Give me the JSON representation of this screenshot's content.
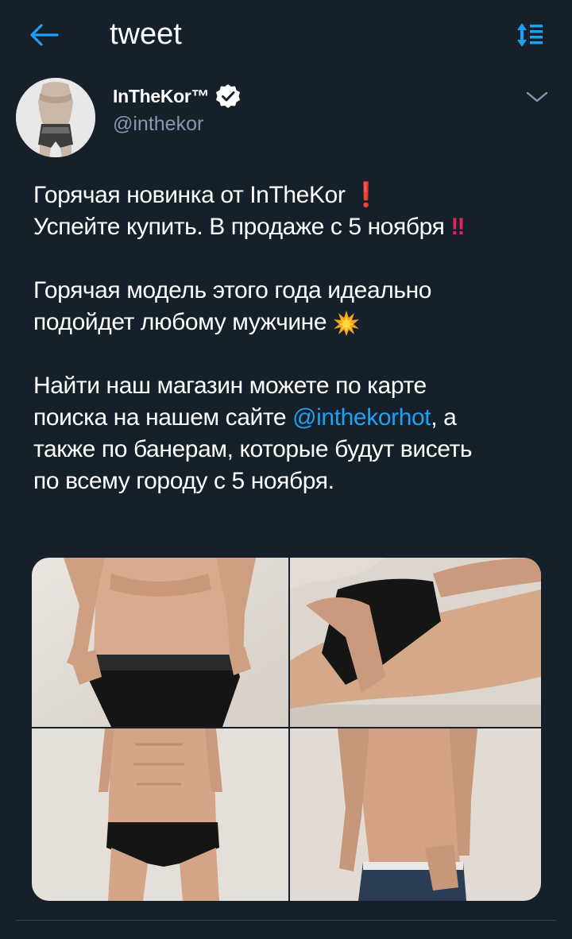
{
  "header": {
    "title": "tweet",
    "back_icon": "arrow-left-icon",
    "sort_icon": "sort-list-icon",
    "accent_color": "#1da1f2"
  },
  "author": {
    "name": "InTheKor™",
    "handle": "@inthekor",
    "verified": true,
    "caret_icon": "chevron-down-icon"
  },
  "tweet": {
    "line1": "Горячая новинка от InTheKor",
    "line1_emoji": "❗",
    "line2": "Успейте купить. В продаже с 5 ноября",
    "line2_emoji": "‼",
    "para2_line1": "Горячая модель этого года идеально",
    "para2_line2": "подойдет любому мужчине",
    "para2_emoji": "collision-emoji",
    "para3_line1": "Найти наш магазин можете по карте",
    "para3_line2_before": "поиска на нашем сайте ",
    "para3_mention": "@inthekorhot",
    "para3_line2_after": ", а",
    "para3_line3": "также по банерам, которые будут висеть",
    "para3_line4": "по всему городу с 5 ноября."
  },
  "media": {
    "count": 4,
    "photos": [
      "photo-1",
      "photo-2",
      "photo-3",
      "photo-4"
    ]
  },
  "colors": {
    "background": "#15202b",
    "text_secondary": "#8899a6",
    "link": "#1da1f2",
    "verified": "#ffffff"
  }
}
